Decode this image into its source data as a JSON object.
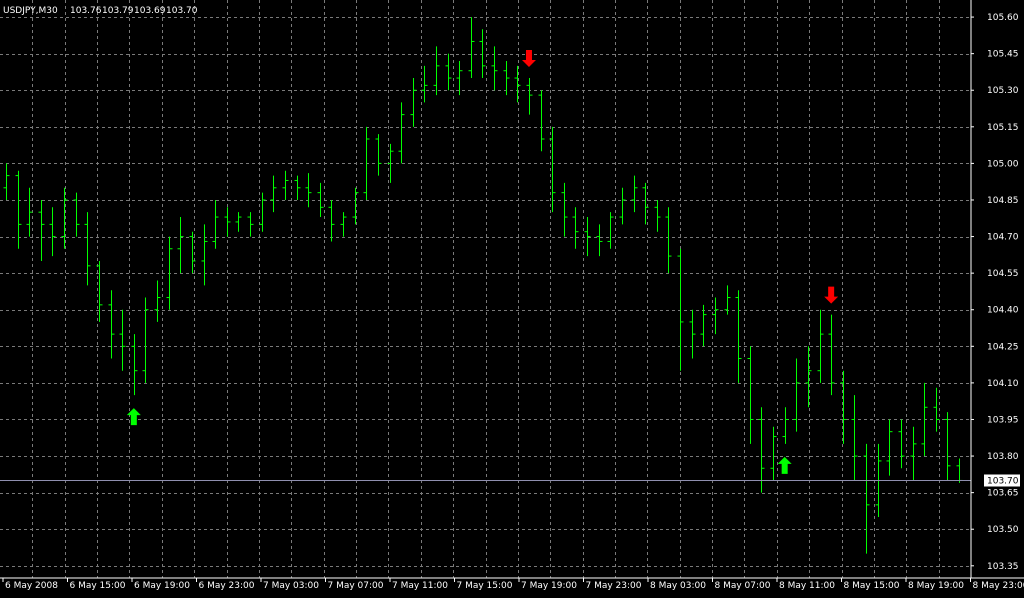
{
  "chart_data": {
    "type": "ohlc",
    "symbol": "USDJPY,M30",
    "title": "USDJPY,M30",
    "header_values": [
      "103.76",
      "103.79",
      "103.69",
      "103.70"
    ],
    "current_price": "103.70",
    "x_tick_labels": [
      "6 May 2008",
      "6 May 15:00",
      "6 May 19:00",
      "6 May 23:00",
      "7 May 03:00",
      "7 May 07:00",
      "7 May 11:00",
      "7 May 15:00",
      "7 May 19:00",
      "7 May 23:00",
      "8 May 03:00",
      "8 May 07:00",
      "8 May 11:00",
      "8 May 15:00",
      "8 May 19:00",
      "8 May 23:00"
    ],
    "y_tick_labels": [
      "105.60",
      "105.45",
      "105.30",
      "105.15",
      "105.00",
      "104.85",
      "104.70",
      "104.55",
      "104.40",
      "104.25",
      "104.10",
      "103.95",
      "103.80",
      "103.65",
      "103.50",
      "103.35"
    ],
    "ylim": [
      103.3,
      105.67
    ],
    "grid": true,
    "colors": {
      "background": "#000000",
      "bar": "#00ff00",
      "grid": "#7a7a7a",
      "axis": "#ffffff",
      "text": "#ffffff",
      "price_line": "#8f8faf",
      "buy_arrow": "#00ff00",
      "sell_arrow": "#ff0000"
    },
    "bars": [
      [
        104.9,
        105.0,
        104.85,
        104.95
      ],
      [
        104.95,
        104.97,
        104.65,
        104.75
      ],
      [
        104.75,
        104.9,
        104.7,
        104.8
      ],
      [
        104.8,
        104.85,
        104.6,
        104.75
      ],
      [
        104.75,
        104.82,
        104.62,
        104.7
      ],
      [
        104.7,
        104.9,
        104.65,
        104.85
      ],
      [
        104.85,
        104.88,
        104.7,
        104.75
      ],
      [
        104.75,
        104.8,
        104.5,
        104.58
      ],
      [
        104.58,
        104.6,
        104.35,
        104.42
      ],
      [
        104.42,
        104.48,
        104.2,
        104.3
      ],
      [
        104.3,
        104.4,
        104.15,
        104.25
      ],
      [
        104.25,
        104.3,
        104.05,
        104.15
      ],
      [
        104.15,
        104.45,
        104.1,
        104.4
      ],
      [
        104.4,
        104.52,
        104.35,
        104.45
      ],
      [
        104.45,
        104.7,
        104.4,
        104.65
      ],
      [
        104.65,
        104.78,
        104.55,
        104.7
      ],
      [
        104.7,
        104.72,
        104.55,
        104.6
      ],
      [
        104.6,
        104.75,
        104.5,
        104.68
      ],
      [
        104.68,
        104.85,
        104.65,
        104.78
      ],
      [
        104.78,
        104.82,
        104.7,
        104.76
      ],
      [
        104.76,
        104.8,
        104.72,
        104.78
      ],
      [
        104.78,
        104.8,
        104.7,
        104.75
      ],
      [
        104.75,
        104.88,
        104.72,
        104.85
      ],
      [
        104.85,
        104.95,
        104.8,
        104.9
      ],
      [
        104.9,
        104.97,
        104.85,
        104.93
      ],
      [
        104.93,
        104.95,
        104.85,
        104.9
      ],
      [
        104.9,
        104.96,
        104.82,
        104.88
      ],
      [
        104.88,
        104.92,
        104.78,
        104.82
      ],
      [
        104.82,
        104.85,
        104.68,
        104.75
      ],
      [
        104.75,
        104.8,
        104.7,
        104.78
      ],
      [
        104.78,
        104.9,
        104.75,
        104.88
      ],
      [
        104.88,
        105.15,
        104.85,
        105.1
      ],
      [
        105.1,
        105.12,
        104.95,
        105.0
      ],
      [
        105.0,
        105.08,
        104.92,
        105.05
      ],
      [
        105.05,
        105.25,
        105.0,
        105.2
      ],
      [
        105.2,
        105.35,
        105.15,
        105.3
      ],
      [
        105.3,
        105.4,
        105.25,
        105.32
      ],
      [
        105.32,
        105.48,
        105.28,
        105.4
      ],
      [
        105.4,
        105.45,
        105.3,
        105.35
      ],
      [
        105.35,
        105.42,
        105.28,
        105.38
      ],
      [
        105.38,
        105.6,
        105.35,
        105.5
      ],
      [
        105.5,
        105.55,
        105.35,
        105.4
      ],
      [
        105.4,
        105.48,
        105.3,
        105.38
      ],
      [
        105.38,
        105.42,
        105.28,
        105.35
      ],
      [
        105.35,
        105.4,
        105.25,
        105.32
      ],
      [
        105.32,
        105.35,
        105.2,
        105.28
      ],
      [
        105.28,
        105.3,
        105.05,
        105.1
      ],
      [
        105.1,
        105.15,
        104.8,
        104.88
      ],
      [
        104.88,
        104.92,
        104.7,
        104.78
      ],
      [
        104.78,
        104.82,
        104.65,
        104.72
      ],
      [
        104.72,
        104.78,
        104.62,
        104.7
      ],
      [
        104.7,
        104.75,
        104.62,
        104.68
      ],
      [
        104.68,
        104.8,
        104.65,
        104.78
      ],
      [
        104.78,
        104.9,
        104.75,
        104.85
      ],
      [
        104.85,
        104.95,
        104.8,
        104.9
      ],
      [
        104.9,
        104.92,
        104.75,
        104.82
      ],
      [
        104.82,
        104.85,
        104.72,
        104.78
      ],
      [
        104.78,
        104.82,
        104.55,
        104.62
      ],
      [
        104.62,
        104.65,
        104.15,
        104.35
      ],
      [
        104.35,
        104.4,
        104.2,
        104.3
      ],
      [
        104.3,
        104.42,
        104.25,
        104.38
      ],
      [
        104.38,
        104.45,
        104.3,
        104.4
      ],
      [
        104.4,
        104.5,
        104.38,
        104.45
      ],
      [
        104.45,
        104.48,
        104.1,
        104.2
      ],
      [
        104.2,
        104.25,
        103.85,
        103.95
      ],
      [
        103.95,
        104.0,
        103.65,
        103.75
      ],
      [
        103.75,
        103.92,
        103.7,
        103.88
      ],
      [
        103.88,
        104.0,
        103.85,
        103.95
      ],
      [
        103.95,
        104.2,
        103.9,
        104.1
      ],
      [
        104.1,
        104.25,
        104.0,
        104.15
      ],
      [
        104.15,
        104.4,
        104.1,
        104.3
      ],
      [
        104.3,
        104.38,
        104.05,
        104.1
      ],
      [
        104.1,
        104.15,
        103.85,
        103.95
      ],
      [
        103.95,
        104.05,
        103.7,
        103.8
      ],
      [
        103.8,
        103.85,
        103.4,
        103.6
      ],
      [
        103.6,
        103.85,
        103.55,
        103.78
      ],
      [
        103.78,
        103.95,
        103.72,
        103.9
      ],
      [
        103.9,
        103.95,
        103.75,
        103.8
      ],
      [
        103.8,
        103.92,
        103.7,
        103.85
      ],
      [
        103.85,
        104.1,
        103.8,
        104.0
      ],
      [
        104.0,
        104.08,
        103.9,
        103.95
      ],
      [
        103.95,
        103.98,
        103.7,
        103.76
      ],
      [
        103.76,
        103.79,
        103.69,
        103.7
      ]
    ]
  },
  "signals": [
    {
      "type": "buy",
      "bar": 11
    },
    {
      "type": "sell",
      "bar": 45
    },
    {
      "type": "buy",
      "bar": 67
    },
    {
      "type": "sell",
      "bar": 71
    }
  ]
}
